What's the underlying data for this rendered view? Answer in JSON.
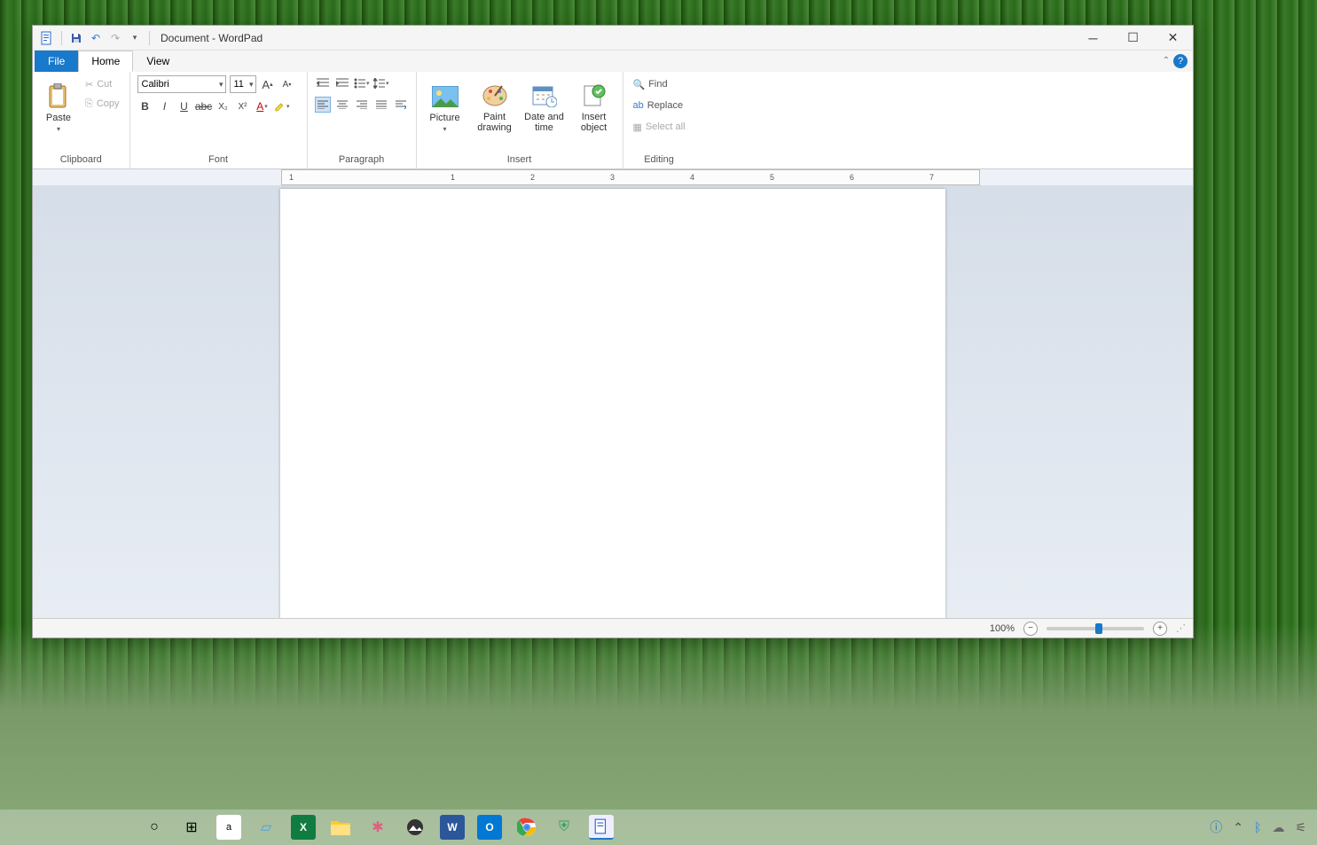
{
  "window": {
    "title": "Document - WordPad"
  },
  "tabs": {
    "file": "File",
    "home": "Home",
    "view": "View"
  },
  "clipboard": {
    "paste": "Paste",
    "cut": "Cut",
    "copy": "Copy",
    "label": "Clipboard"
  },
  "font": {
    "name": "Calibri",
    "size": "11",
    "label": "Font"
  },
  "paragraph": {
    "label": "Paragraph"
  },
  "insert": {
    "picture": "Picture",
    "paint": "Paint drawing",
    "datetime": "Date and time",
    "object": "Insert object",
    "label": "Insert"
  },
  "editing": {
    "find": "Find",
    "replace": "Replace",
    "selectall": "Select all",
    "label": "Editing"
  },
  "ruler": {
    "marks": [
      "1",
      "",
      "1",
      "2",
      "3",
      "4",
      "5",
      "6",
      "7"
    ]
  },
  "status": {
    "zoom": "100%"
  }
}
